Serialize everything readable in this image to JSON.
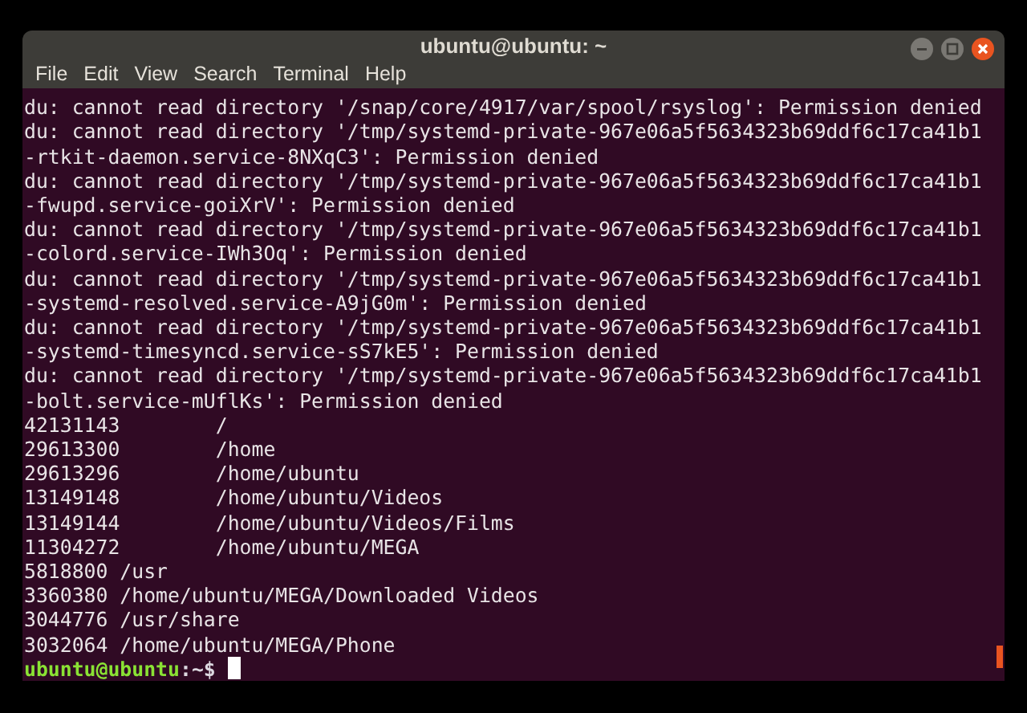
{
  "window": {
    "title": "ubuntu@ubuntu: ~"
  },
  "menu": [
    {
      "label": "File"
    },
    {
      "label": "Edit"
    },
    {
      "label": "View"
    },
    {
      "label": "Search"
    },
    {
      "label": "Terminal"
    },
    {
      "label": "Help"
    }
  ],
  "terminal": {
    "lines": [
      "du: cannot read directory '/snap/core/4917/var/spool/rsyslog': Permission denied",
      "du: cannot read directory '/tmp/systemd-private-967e06a5f5634323b69ddf6c17ca41b1",
      "-rtkit-daemon.service-8NXqC3': Permission denied",
      "du: cannot read directory '/tmp/systemd-private-967e06a5f5634323b69ddf6c17ca41b1",
      "-fwupd.service-goiXrV': Permission denied",
      "du: cannot read directory '/tmp/systemd-private-967e06a5f5634323b69ddf6c17ca41b1",
      "-colord.service-IWh3Oq': Permission denied",
      "du: cannot read directory '/tmp/systemd-private-967e06a5f5634323b69ddf6c17ca41b1",
      "-systemd-resolved.service-A9jG0m': Permission denied",
      "du: cannot read directory '/tmp/systemd-private-967e06a5f5634323b69ddf6c17ca41b1",
      "-systemd-timesyncd.service-sS7kE5': Permission denied",
      "du: cannot read directory '/tmp/systemd-private-967e06a5f5634323b69ddf6c17ca41b1",
      "-bolt.service-mUflKs': Permission denied",
      "42131143\t/",
      "29613300\t/home",
      "29613296\t/home/ubuntu",
      "13149148\t/home/ubuntu/Videos",
      "13149144\t/home/ubuntu/Videos/Films",
      "11304272\t/home/ubuntu/MEGA",
      "5818800 /usr",
      "3360380 /home/ubuntu/MEGA/Downloaded Videos",
      "3044776 /usr/share",
      "3032064 /home/ubuntu/MEGA/Phone"
    ],
    "prompt": {
      "user_host": "ubuntu@ubuntu",
      "path": ":~$"
    }
  }
}
